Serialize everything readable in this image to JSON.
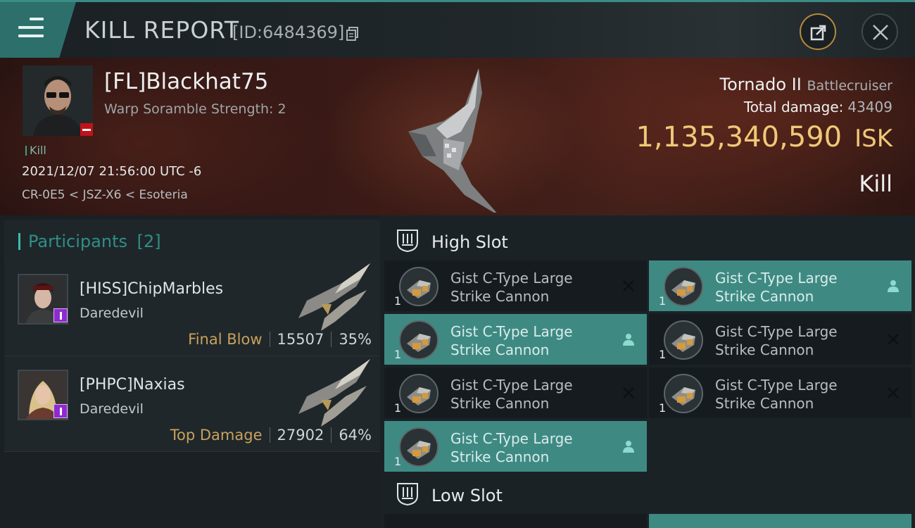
{
  "header": {
    "title": "KILL REPORT",
    "id_text": "[ID:6484369]"
  },
  "victim": {
    "name": "[FL]Blackhat75",
    "subtitle": "Warp Soramble Strength: 2",
    "tag": "Kill",
    "time": "2021/12/07 21:56:00 UTC -6",
    "location": "CR-0E5 < JSZ-X6 < Esoteria",
    "ship_name": "Tornado II",
    "ship_class": "Battlecruiser",
    "total_damage_label": "Total damage:",
    "total_damage": "43409",
    "isk_value": "1,135,340,590",
    "isk_unit": "ISK",
    "result": "Kill"
  },
  "participants": {
    "title": "Participants",
    "count": "[2]",
    "rows": [
      {
        "name": "[HISS]ChipMarbles",
        "ship": "Daredevil",
        "role": "Final Blow",
        "damage": "15507",
        "percent": "35%"
      },
      {
        "name": "[PHPC]Naxias",
        "ship": "Daredevil",
        "role": "Top Damage",
        "damage": "27902",
        "percent": "64%"
      }
    ]
  },
  "slots": {
    "high_label": "High Slot",
    "low_label": "Low Slot",
    "modules": [
      {
        "line1": "Gist C-Type Large",
        "line2": "Strike Cannon",
        "qty": "1",
        "state": "destroyed"
      },
      {
        "line1": "Gist C-Type Large",
        "line2": "Strike Cannon",
        "qty": "1",
        "state": "dropped"
      },
      {
        "line1": "Gist C-Type Large",
        "line2": "Strike Cannon",
        "qty": "1",
        "state": "dropped"
      },
      {
        "line1": "Gist C-Type Large",
        "line2": "Strike Cannon",
        "qty": "1",
        "state": "destroyed"
      },
      {
        "line1": "Gist C-Type Large",
        "line2": "Strike Cannon",
        "qty": "1",
        "state": "destroyed"
      },
      {
        "line1": "Gist C-Type Large",
        "line2": "Strike Cannon",
        "qty": "1",
        "state": "destroyed"
      },
      {
        "line1": "Gist C-Type Large",
        "line2": "Strike Cannon",
        "qty": "1",
        "state": "dropped"
      }
    ]
  },
  "colors": {
    "accent": "#3e8a83",
    "isk": "#f0c878",
    "role": "#c9a15b"
  }
}
